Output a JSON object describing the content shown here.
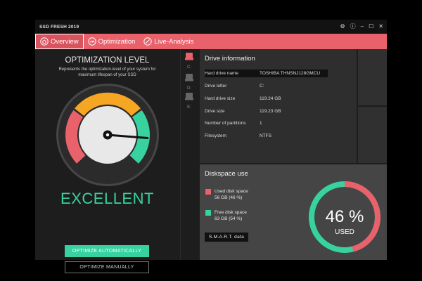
{
  "app": {
    "title": "SSD FRESH 2019"
  },
  "window_controls": [
    {
      "name": "settings-icon",
      "glyph": "⚙"
    },
    {
      "name": "info-icon",
      "glyph": "ⓘ"
    },
    {
      "name": "minimize-icon",
      "glyph": "–"
    },
    {
      "name": "maximize-icon",
      "glyph": "☐"
    },
    {
      "name": "close-icon",
      "glyph": "✕"
    }
  ],
  "nav": {
    "tabs": [
      {
        "label": "Overview",
        "icon": "home-icon",
        "active": true
      },
      {
        "label": "Optimization",
        "icon": "speedometer-icon",
        "active": false
      },
      {
        "label": "Live-Analysis",
        "icon": "live-analysis-icon",
        "active": false
      }
    ]
  },
  "optimization": {
    "title": "OPTIMIZATION LEVEL",
    "subtitle": "Represents the optimization-level of your system for maximum lifespan of your SSD",
    "status": "EXCELLENT",
    "level": 0.85,
    "auto_button": "OPTIMIZE AUTOMATICALLY",
    "manual_button": "OPTIMIZE MANUALLY"
  },
  "drives": [
    {
      "letter": "C:",
      "selected": true
    },
    {
      "letter": "D:",
      "selected": false
    },
    {
      "letter": "E:",
      "selected": false
    }
  ],
  "drive_info": {
    "title": "Drive information",
    "rows": [
      {
        "label": "Hard drive name",
        "value": "TOSHIBA THNSNJ128GMCU"
      },
      {
        "label": "Drive letter",
        "value": "C:"
      },
      {
        "label": "Hard drive size",
        "value": "119.24   GB"
      },
      {
        "label": "Drive size",
        "value": "119.23   GB"
      },
      {
        "label": "Number of partitions",
        "value": "1"
      },
      {
        "label": "Filesystem",
        "value": "NTFS"
      }
    ]
  },
  "diskspace": {
    "title": "Diskspace use",
    "used_label": "Used disk space",
    "used_value": "56 GB (46 %)",
    "free_label": "Free disk space",
    "free_value": "63 GB (54 %)",
    "smart_button": "S.M.A.R.T. data",
    "percent": "46 %",
    "used_caption": "USED",
    "used_fraction": 0.46
  },
  "colors": {
    "accent": "#e9616b",
    "green": "#37d2a0",
    "orange": "#f5a623",
    "dark": "#1d1d1d"
  }
}
